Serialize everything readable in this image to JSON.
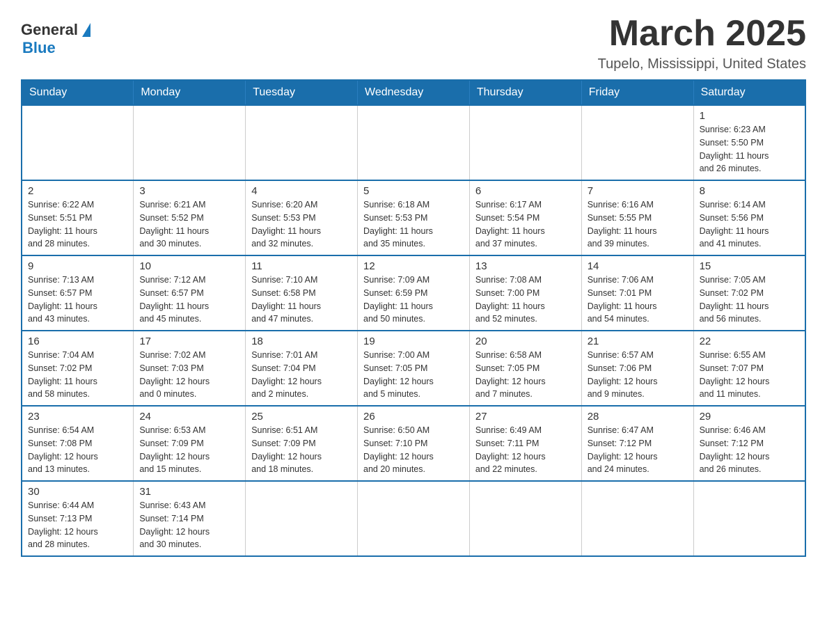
{
  "header": {
    "logo_general": "General",
    "logo_blue": "Blue",
    "month_title": "March 2025",
    "location": "Tupelo, Mississippi, United States"
  },
  "weekdays": [
    "Sunday",
    "Monday",
    "Tuesday",
    "Wednesday",
    "Thursday",
    "Friday",
    "Saturday"
  ],
  "weeks": [
    [
      {
        "day": "",
        "info": ""
      },
      {
        "day": "",
        "info": ""
      },
      {
        "day": "",
        "info": ""
      },
      {
        "day": "",
        "info": ""
      },
      {
        "day": "",
        "info": ""
      },
      {
        "day": "",
        "info": ""
      },
      {
        "day": "1",
        "info": "Sunrise: 6:23 AM\nSunset: 5:50 PM\nDaylight: 11 hours\nand 26 minutes."
      }
    ],
    [
      {
        "day": "2",
        "info": "Sunrise: 6:22 AM\nSunset: 5:51 PM\nDaylight: 11 hours\nand 28 minutes."
      },
      {
        "day": "3",
        "info": "Sunrise: 6:21 AM\nSunset: 5:52 PM\nDaylight: 11 hours\nand 30 minutes."
      },
      {
        "day": "4",
        "info": "Sunrise: 6:20 AM\nSunset: 5:53 PM\nDaylight: 11 hours\nand 32 minutes."
      },
      {
        "day": "5",
        "info": "Sunrise: 6:18 AM\nSunset: 5:53 PM\nDaylight: 11 hours\nand 35 minutes."
      },
      {
        "day": "6",
        "info": "Sunrise: 6:17 AM\nSunset: 5:54 PM\nDaylight: 11 hours\nand 37 minutes."
      },
      {
        "day": "7",
        "info": "Sunrise: 6:16 AM\nSunset: 5:55 PM\nDaylight: 11 hours\nand 39 minutes."
      },
      {
        "day": "8",
        "info": "Sunrise: 6:14 AM\nSunset: 5:56 PM\nDaylight: 11 hours\nand 41 minutes."
      }
    ],
    [
      {
        "day": "9",
        "info": "Sunrise: 7:13 AM\nSunset: 6:57 PM\nDaylight: 11 hours\nand 43 minutes."
      },
      {
        "day": "10",
        "info": "Sunrise: 7:12 AM\nSunset: 6:57 PM\nDaylight: 11 hours\nand 45 minutes."
      },
      {
        "day": "11",
        "info": "Sunrise: 7:10 AM\nSunset: 6:58 PM\nDaylight: 11 hours\nand 47 minutes."
      },
      {
        "day": "12",
        "info": "Sunrise: 7:09 AM\nSunset: 6:59 PM\nDaylight: 11 hours\nand 50 minutes."
      },
      {
        "day": "13",
        "info": "Sunrise: 7:08 AM\nSunset: 7:00 PM\nDaylight: 11 hours\nand 52 minutes."
      },
      {
        "day": "14",
        "info": "Sunrise: 7:06 AM\nSunset: 7:01 PM\nDaylight: 11 hours\nand 54 minutes."
      },
      {
        "day": "15",
        "info": "Sunrise: 7:05 AM\nSunset: 7:02 PM\nDaylight: 11 hours\nand 56 minutes."
      }
    ],
    [
      {
        "day": "16",
        "info": "Sunrise: 7:04 AM\nSunset: 7:02 PM\nDaylight: 11 hours\nand 58 minutes."
      },
      {
        "day": "17",
        "info": "Sunrise: 7:02 AM\nSunset: 7:03 PM\nDaylight: 12 hours\nand 0 minutes."
      },
      {
        "day": "18",
        "info": "Sunrise: 7:01 AM\nSunset: 7:04 PM\nDaylight: 12 hours\nand 2 minutes."
      },
      {
        "day": "19",
        "info": "Sunrise: 7:00 AM\nSunset: 7:05 PM\nDaylight: 12 hours\nand 5 minutes."
      },
      {
        "day": "20",
        "info": "Sunrise: 6:58 AM\nSunset: 7:05 PM\nDaylight: 12 hours\nand 7 minutes."
      },
      {
        "day": "21",
        "info": "Sunrise: 6:57 AM\nSunset: 7:06 PM\nDaylight: 12 hours\nand 9 minutes."
      },
      {
        "day": "22",
        "info": "Sunrise: 6:55 AM\nSunset: 7:07 PM\nDaylight: 12 hours\nand 11 minutes."
      }
    ],
    [
      {
        "day": "23",
        "info": "Sunrise: 6:54 AM\nSunset: 7:08 PM\nDaylight: 12 hours\nand 13 minutes."
      },
      {
        "day": "24",
        "info": "Sunrise: 6:53 AM\nSunset: 7:09 PM\nDaylight: 12 hours\nand 15 minutes."
      },
      {
        "day": "25",
        "info": "Sunrise: 6:51 AM\nSunset: 7:09 PM\nDaylight: 12 hours\nand 18 minutes."
      },
      {
        "day": "26",
        "info": "Sunrise: 6:50 AM\nSunset: 7:10 PM\nDaylight: 12 hours\nand 20 minutes."
      },
      {
        "day": "27",
        "info": "Sunrise: 6:49 AM\nSunset: 7:11 PM\nDaylight: 12 hours\nand 22 minutes."
      },
      {
        "day": "28",
        "info": "Sunrise: 6:47 AM\nSunset: 7:12 PM\nDaylight: 12 hours\nand 24 minutes."
      },
      {
        "day": "29",
        "info": "Sunrise: 6:46 AM\nSunset: 7:12 PM\nDaylight: 12 hours\nand 26 minutes."
      }
    ],
    [
      {
        "day": "30",
        "info": "Sunrise: 6:44 AM\nSunset: 7:13 PM\nDaylight: 12 hours\nand 28 minutes."
      },
      {
        "day": "31",
        "info": "Sunrise: 6:43 AM\nSunset: 7:14 PM\nDaylight: 12 hours\nand 30 minutes."
      },
      {
        "day": "",
        "info": ""
      },
      {
        "day": "",
        "info": ""
      },
      {
        "day": "",
        "info": ""
      },
      {
        "day": "",
        "info": ""
      },
      {
        "day": "",
        "info": ""
      }
    ]
  ],
  "colors": {
    "header_bg": "#1a6eab",
    "header_text": "#ffffff",
    "border": "#1a6eab",
    "logo_blue": "#1a7abf"
  }
}
